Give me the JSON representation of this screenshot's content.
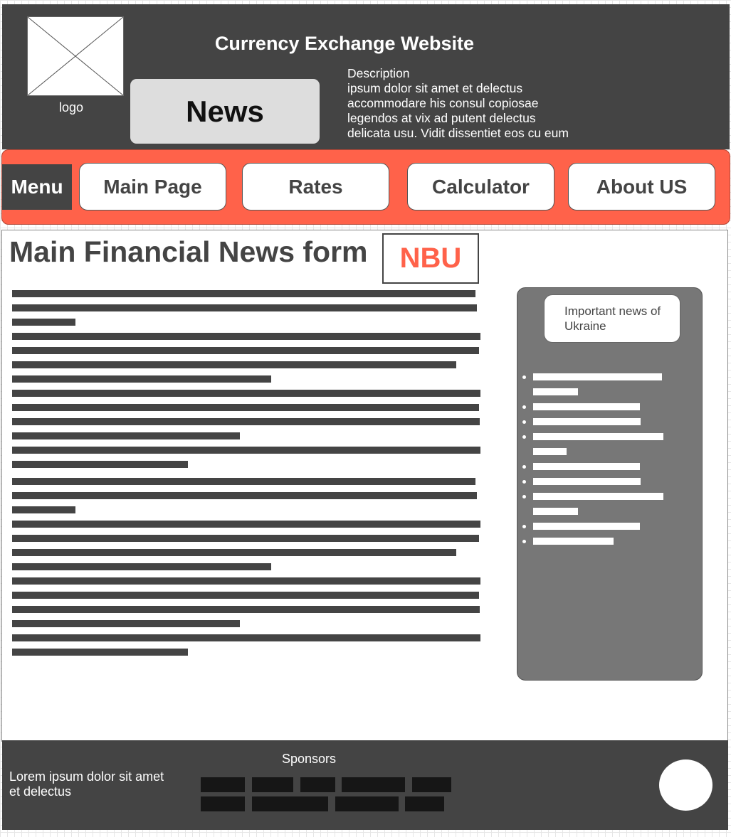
{
  "header": {
    "logo_label": "logo",
    "site_title": "Currency Exchange Website",
    "news_label": "News",
    "description": [
      "Description",
      "ipsum dolor sit amet et delectus",
      "accommodare his consul copiosae",
      "legendos at vix ad putent delectus",
      "delicata usu. Vidit dissentiet eos cu eum"
    ]
  },
  "nav": {
    "menu_label": "Menu",
    "items": [
      "Main Page",
      "Rates",
      "Calculator",
      "About US"
    ]
  },
  "main": {
    "title": "Main Financial News form",
    "badge": "NBU"
  },
  "sidebar": {
    "heading_line1": "Important news of",
    "heading_line2": "Ukraine"
  },
  "footer": {
    "sponsors_label": "Sponsors",
    "text_line1": "Lorem ipsum dolor sit amet",
    "text_line2": "et delectus"
  },
  "colors": {
    "dark": "#444444",
    "accent": "#ff624a",
    "news_box": "#dddddd",
    "sidebar": "#777777"
  }
}
